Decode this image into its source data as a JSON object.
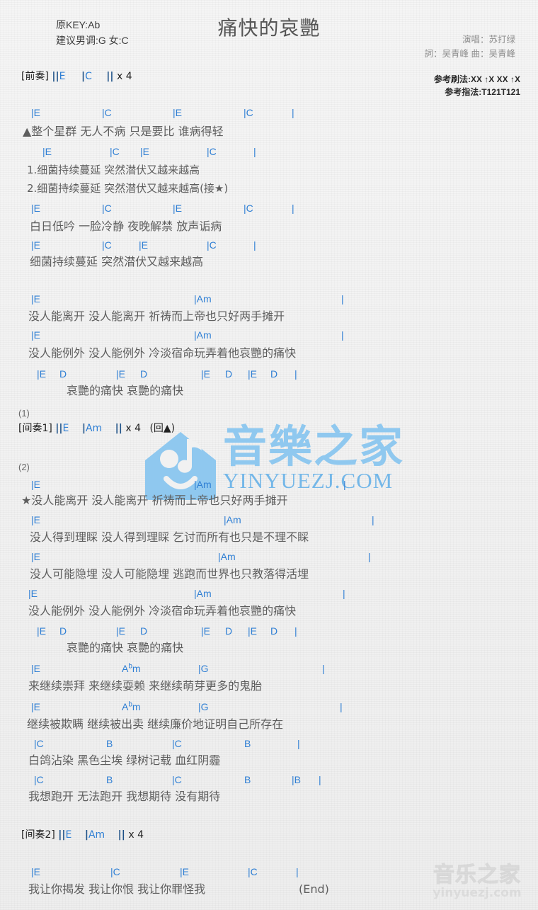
{
  "header": {
    "title": "痛快的哀艷",
    "original_key": "原KEY:Ab",
    "suggested_key": "建议男调:G 女:C",
    "singer": "演唱：苏打绿",
    "writers": "詞：吴青峰  曲：吴青峰",
    "strum_pattern": "参考刷法:XX ↑X XX ↑X",
    "finger_pattern": "参考指法:T121T121"
  },
  "intro": {
    "label": "[前奏]",
    "bars": "||E   |C   || x 4",
    "bar1": "||",
    "chord1": "E",
    "bar2": "|",
    "chord2": "C",
    "bar3": "||",
    "times": "x 4"
  },
  "interlude1": {
    "number": "(1)",
    "label": "[间奏1]",
    "bar1": "||",
    "chord1": "E",
    "bar2": "|",
    "chord2": "Am",
    "bar3": "||",
    "times": "x 4",
    "note": "(回▲)"
  },
  "interlude2": {
    "number": "(2)",
    "label": "[间奏2]",
    "bar1": "||",
    "chord1": "E",
    "bar2": "|",
    "chord2": "Am",
    "bar3": "||",
    "times": "x 4"
  },
  "end_marker": "(End)",
  "verse1": {
    "l1_chords": [
      "|E",
      "|C",
      "|E",
      "|C",
      "|"
    ],
    "l1_lyric": "▲整个星群   无人不病   只是要比   谁病得轻",
    "l2_chords": [
      "|E",
      "|C",
      "|E",
      "|C",
      "|"
    ],
    "l2_lyric_1": "1.细菌持续蔓延   突然潜伏又越来越高",
    "l2_lyric_2": "2.细菌持续蔓延   突然潜伏又越来越高(接★)",
    "l3_chords": [
      "|E",
      "|C",
      "|E",
      "|C",
      "|"
    ],
    "l3_lyric": "白日低吟   一脸冷静   夜晚解禁   放声诟病",
    "l4_chords": [
      "|E",
      "|C",
      "|E",
      "|C",
      "|"
    ],
    "l4_lyric": "细菌持续蔓延     突然潜伏又越来越高"
  },
  "chorus1": {
    "l1_chords": [
      "|E",
      "|Am",
      "|"
    ],
    "l1_lyric": "没人能离开   没人能离开   祈祷而上帝也只好两手摊开",
    "l2_chords": [
      "|E",
      "|Am",
      "|"
    ],
    "l2_lyric": "没人能例外   没人能例外   冷淡宿命玩弄着他哀艷的痛快",
    "l3_chords": [
      "|E",
      "D",
      "|E",
      "D",
      "|E",
      "D",
      "|E",
      "D",
      "|"
    ],
    "l3_lyric": "哀艷的痛快      哀艷的痛快"
  },
  "chorus2": {
    "l1_chords": [
      "|E",
      "|Am",
      "|"
    ],
    "l1_lyric": "★没人能离开   没人能离开   祈祷而上帝也只好两手摊开",
    "l2_chords": [
      "|E",
      "|Am",
      "|"
    ],
    "l2_lyric": "没人得到理睬   没人得到理睬   乞讨而所有也只是不理不睬",
    "l3_chords": [
      "|E",
      "|Am",
      "|"
    ],
    "l3_lyric": "没人可能隐埋   没人可能隐埋   逃跑而世界也只教落得活埋",
    "l4_chords": [
      "|E",
      "|Am",
      "|"
    ],
    "l4_lyric": "没人能例外   没人能例外   冷淡宿命玩弄着他哀艷的痛快",
    "l5_chords": [
      "|E",
      "D",
      "|E",
      "D",
      "|E",
      "D",
      "|E",
      "D",
      "|"
    ],
    "l5_lyric": "哀艷的痛快      哀艷的痛快"
  },
  "bridge": {
    "l1_chords": [
      "|E",
      "Abm",
      "|G",
      "|"
    ],
    "l1_lyric": "来继续崇拜   来继续耍赖   来继续萌芽更多的鬼胎",
    "l2_chords": [
      "|E",
      "Abm",
      "|G",
      "|"
    ],
    "l2_lyric": "继续被欺瞒   继续被出卖   继续廉价地证明自己所存在",
    "l3_chords": [
      "|C",
      "B",
      "|C",
      "B",
      "|"
    ],
    "l3_lyric": "白鸽沾染   黑色尘埃   绿树记载   血红阴霾",
    "l4_chords": [
      "|C",
      "B",
      "|C",
      "B",
      "|B",
      "|"
    ],
    "l4_lyric": "我想跑开   无法跑开   我想期待   没有期待"
  },
  "outro": {
    "l1_chords": [
      "|E",
      "|C",
      "|E",
      "|C",
      "|"
    ],
    "l1_lyric": "我让你揭发   我让你恨   我让你罪怪我"
  },
  "watermark": {
    "main_text": "音樂之家",
    "main_url": "YINYUEZJ.COM",
    "bottom_text": "音乐之家",
    "bottom_url": "yinyuezj.com"
  },
  "colors": {
    "chord": "#2f7fd4",
    "bar": "#1b4f86",
    "lyric": "#5e5e5e",
    "watermark": "#8fc8ef"
  }
}
